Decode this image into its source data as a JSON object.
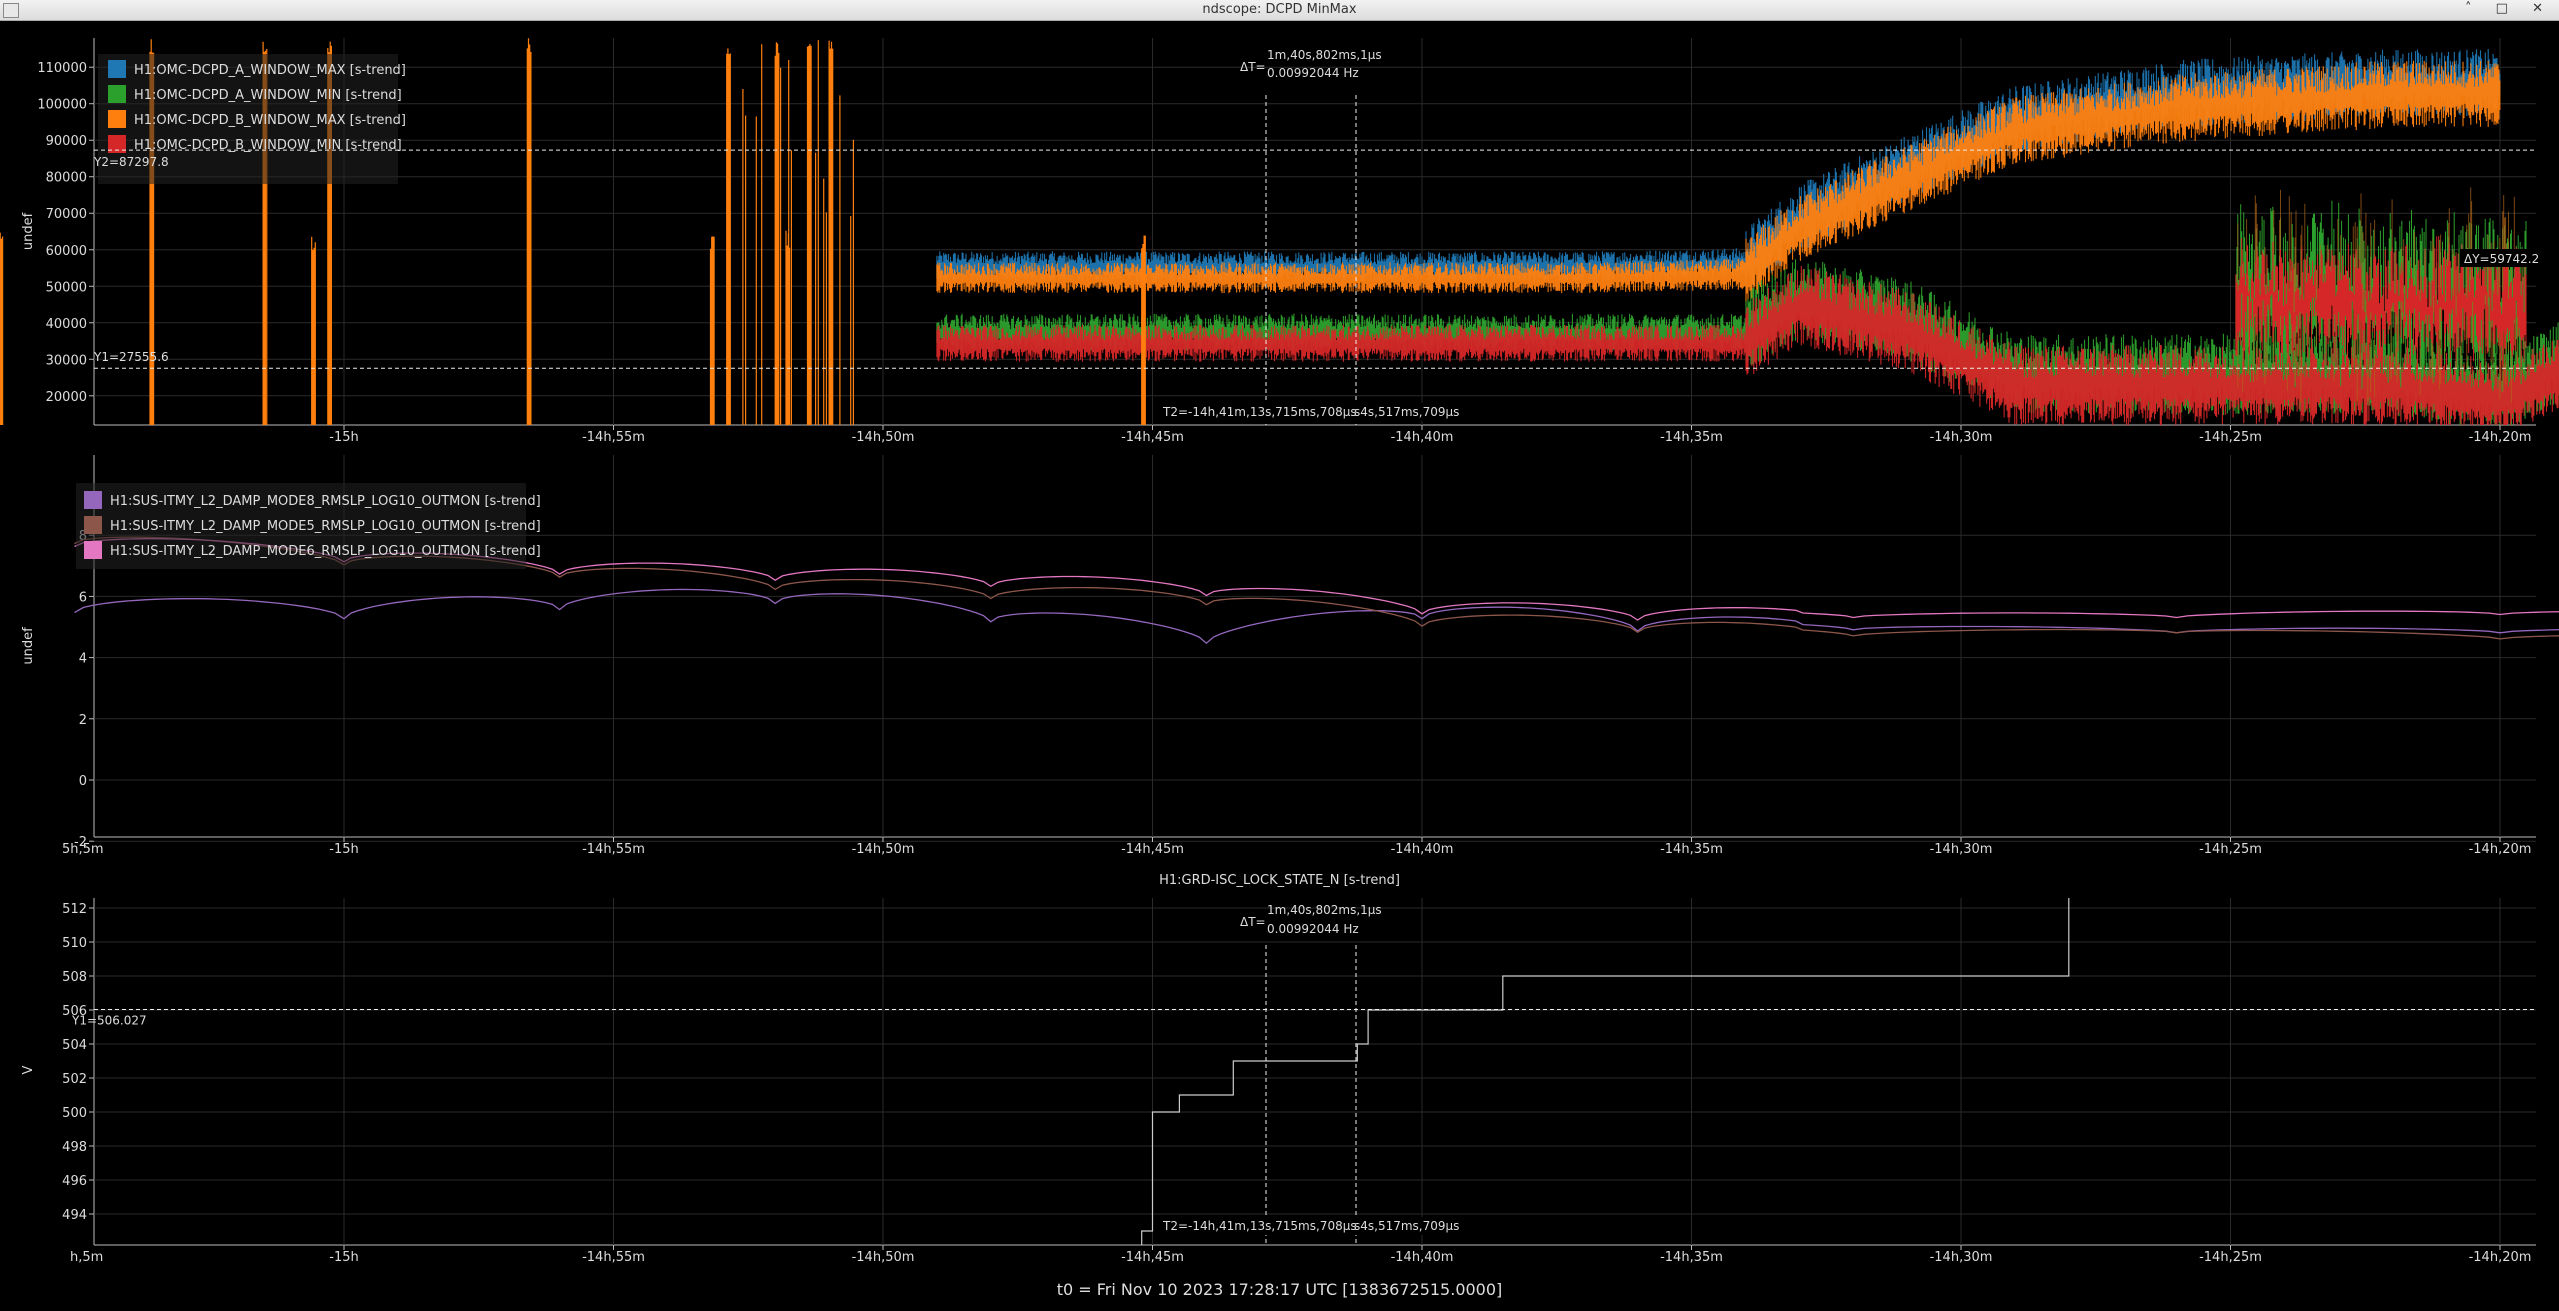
{
  "window": {
    "title": "ndscope: DCPD MinMax",
    "buttons": "˄ □ ✕"
  },
  "t0_label": "t0 = Fri Nov 10 2023 17:28:17 UTC [1383672515.0000]",
  "x_ticks_main": [
    "-15h",
    "-14h,55m",
    "-14h,50m",
    "-14h,45m",
    "-14h,40m",
    "-14h,35m",
    "-14h,30m",
    "-14h,25m",
    "-14h,20m"
  ],
  "x_tick_left_partial": "5h,5m",
  "x_tick_left_partial3": "h,5m",
  "plot1": {
    "ylabel": "undef",
    "yticks": [
      "110000",
      "100000",
      "90000",
      "80000",
      "70000",
      "60000",
      "50000",
      "40000",
      "30000",
      "20000"
    ],
    "legend": [
      {
        "name": "H1:OMC-DCPD_A_WINDOW_MAX [s-trend]",
        "color": "#1f77b4"
      },
      {
        "name": "H1:OMC-DCPD_A_WINDOW_MIN [s-trend]",
        "color": "#2ca02c"
      },
      {
        "name": "H1:OMC-DCPD_B_WINDOW_MAX [s-trend]",
        "color": "#ff7f0e"
      },
      {
        "name": "H1:OMC-DCPD_B_WINDOW_MIN [s-trend]",
        "color": "#d62728"
      }
    ],
    "cursors": {
      "y2": "Y2=87297.8",
      "y1": "Y1=27555.6",
      "dy": "ΔY=59742.2",
      "dt_label": "ΔT=",
      "dt_value": "1m,40s,802ms,1µs",
      "dt_freq": "0.00992044 Hz",
      "t2": "T2=-14h,41m,13s,715ms,708µs",
      "t1_partial": "s4s,517ms,709µs"
    }
  },
  "plot2": {
    "ylabel": "undef",
    "yticks": [
      "8",
      "6",
      "4",
      "2",
      "0",
      "-2"
    ],
    "legend": [
      {
        "name": "H1:SUS-ITMY_L2_DAMP_MODE8_RMSLP_LOG10_OUTMON [s-trend]",
        "color": "#9467bd"
      },
      {
        "name": "H1:SUS-ITMY_L2_DAMP_MODE5_RMSLP_LOG10_OUTMON [s-trend]",
        "color": "#8c564b"
      },
      {
        "name": "H1:SUS-ITMY_L2_DAMP_MODE6_RMSLP_LOG10_OUTMON [s-trend]",
        "color": "#e377c2"
      }
    ]
  },
  "plot3": {
    "title": "H1:GRD-ISC_LOCK_STATE_N [s-trend]",
    "ylabel": "V",
    "yticks": [
      "512",
      "510",
      "508",
      "506",
      "504",
      "502",
      "500",
      "498",
      "496",
      "494"
    ],
    "cursors": {
      "y1": "Y1=506.027",
      "dt_label": "ΔT=",
      "dt_value": "1m,40s,802ms,1µs",
      "dt_freq": "0.00992044 Hz",
      "t2": "T2=-14h,41m,13s,715ms,708µs",
      "t1_partial": "s4s,517ms,709µs"
    }
  },
  "chart_data": [
    {
      "type": "line",
      "title": "",
      "ylabel": "undef",
      "xlabel": "",
      "xlim_min": [
        -910,
        -860
      ],
      "ylim": [
        12000,
        118000
      ],
      "series": [
        {
          "name": "H1:OMC-DCPD_A_WINDOW_MAX [s-trend]",
          "x": [
            -889,
            -885,
            -881,
            -877,
            -874,
            -873,
            -872,
            -869,
            -866,
            -862,
            -860
          ],
          "y": [
            55000,
            55000,
            55000,
            55000,
            56000,
            68000,
            75000,
            95000,
            102000,
            105000,
            105000
          ]
        },
        {
          "name": "H1:OMC-DCPD_A_WINDOW_MIN [s-trend]",
          "x": [
            -889,
            -885,
            -881,
            -877,
            -874,
            -873,
            -871,
            -869,
            -866,
            -862,
            -860,
            -856,
            -853
          ],
          "y": [
            37000,
            37000,
            37000,
            37000,
            37000,
            46000,
            40000,
            25000,
            25000,
            25000,
            20000,
            50000,
            50000
          ]
        },
        {
          "name": "H1:OMC-DCPD_B_WINDOW_MAX [s-trend]",
          "x": [
            -889,
            -885,
            -881,
            -877,
            -874,
            -873,
            -872,
            -869,
            -866,
            -862,
            -860
          ],
          "y": [
            52000,
            52000,
            52000,
            52000,
            53000,
            65000,
            72000,
            92000,
            98000,
            102000,
            102000
          ]
        },
        {
          "name": "H1:OMC-DCPD_B_WINDOW_MIN [s-trend]",
          "x": [
            -889,
            -885,
            -881,
            -877,
            -874,
            -873,
            -871,
            -869,
            -866,
            -862,
            -860,
            -856,
            -853
          ],
          "y": [
            34000,
            34000,
            34000,
            34000,
            34000,
            44000,
            37000,
            22000,
            22000,
            22000,
            18000,
            45000,
            45000
          ]
        }
      ]
    },
    {
      "type": "line",
      "ylabel": "undef",
      "ylim": [
        -2.5,
        9.5
      ],
      "series": [
        {
          "name": "H1:SUS-ITMY_L2_DAMP_MODE8_RMSLP_LOG10_OUTMON [s-trend]",
          "x": [
            -905,
            -900,
            -896,
            -892,
            -888,
            -884,
            -880,
            -876,
            -872,
            -866,
            -860,
            -853
          ],
          "y": [
            5.8,
            5.6,
            5.9,
            6.1,
            5.5,
            4.8,
            5.6,
            5.2,
            5.0,
            4.9,
            4.9,
            4.9
          ]
        },
        {
          "name": "H1:SUS-ITMY_L2_DAMP_MODE5_RMSLP_LOG10_OUTMON [s-trend]",
          "x": [
            -905,
            -900,
            -896,
            -892,
            -888,
            -884,
            -880,
            -876,
            -872,
            -866,
            -860,
            -853
          ],
          "y": [
            8.0,
            7.3,
            6.9,
            6.5,
            6.2,
            6.0,
            5.3,
            5.1,
            4.8,
            4.9,
            4.7,
            4.7
          ]
        },
        {
          "name": "H1:SUS-ITMY_L2_DAMP_MODE6_RMSLP_LOG10_OUTMON [s-trend]",
          "x": [
            -905,
            -900,
            -896,
            -892,
            -888,
            -884,
            -880,
            -876,
            -872,
            -866,
            -860,
            -853
          ],
          "y": [
            7.9,
            7.4,
            7.0,
            6.8,
            6.6,
            6.3,
            5.7,
            5.5,
            5.4,
            5.4,
            5.5,
            5.4
          ]
        }
      ]
    },
    {
      "type": "line",
      "title": "H1:GRD-ISC_LOCK_STATE_N [s-trend]",
      "ylabel": "V",
      "ylim": [
        493,
        513
      ],
      "series": [
        {
          "name": "H1:GRD-ISC_LOCK_STATE_N [s-trend]",
          "x": [
            -885.2,
            -885,
            -884.5,
            -884,
            -883.5,
            -882.5,
            -881.2,
            -881,
            -879.5,
            -878.5,
            -868.5,
            -868
          ],
          "y": [
            493,
            500,
            501,
            501,
            503,
            503,
            504,
            506,
            506,
            508,
            508,
            513
          ]
        }
      ]
    }
  ]
}
